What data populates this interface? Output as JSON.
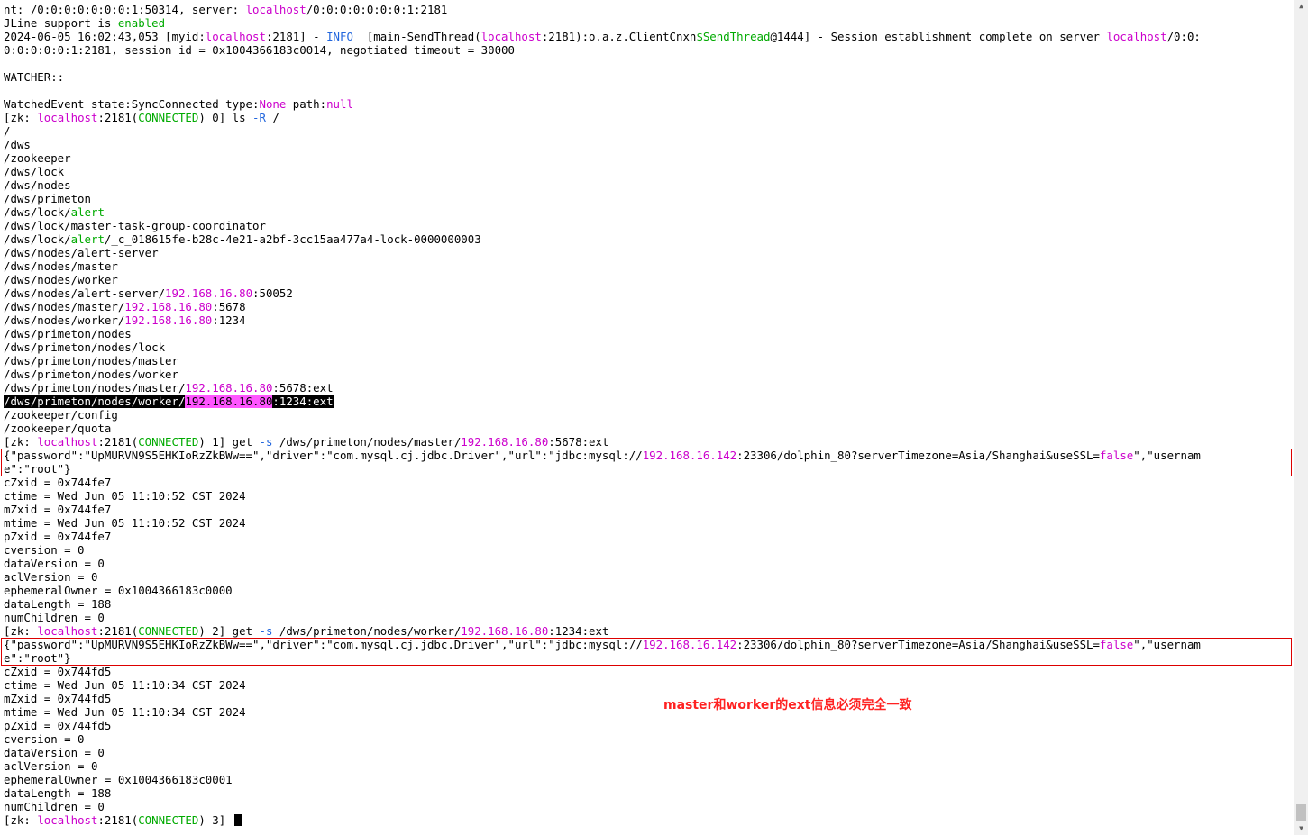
{
  "terminal": {
    "lines": [
      [
        [
          "nt: /0:0:0:0:0:0:0:1:50314, server: ",
          ""
        ],
        [
          "localhost",
          "mag"
        ],
        [
          "/0:0:0:0:0:0:0:1:2181",
          ""
        ]
      ],
      [
        [
          "JLine support is ",
          ""
        ],
        [
          "enabled",
          "grn"
        ]
      ],
      [
        [
          "2024-06-05 16:02:43,053 [myid:",
          ""
        ],
        [
          "localhost",
          "mag"
        ],
        [
          ":2181] - ",
          ""
        ],
        [
          "INFO",
          "blu"
        ],
        [
          "  [main-SendThread(",
          ""
        ],
        [
          "localhost",
          "mag"
        ],
        [
          ":2181):o.a.z.ClientCnxn",
          ""
        ],
        [
          "$SendThread",
          "grn"
        ],
        [
          "@1444] - Session establishment complete on server ",
          ""
        ],
        [
          "localhost",
          "mag"
        ],
        [
          "/0:0:",
          ""
        ]
      ],
      [
        [
          "0:0:0:0:0:1:2181, session id = 0x1004366183c0014, negotiated timeout = 30000",
          ""
        ]
      ],
      [
        [
          "",
          ""
        ]
      ],
      [
        [
          "WATCHER::",
          ""
        ]
      ],
      [
        [
          "",
          ""
        ]
      ],
      [
        [
          "WatchedEvent state:SyncConnected type:",
          ""
        ],
        [
          "None",
          "mag"
        ],
        [
          " path:",
          ""
        ],
        [
          "null",
          "mag"
        ]
      ],
      [
        [
          "[zk: ",
          ""
        ],
        [
          "localhost",
          "mag"
        ],
        [
          ":2181(",
          ""
        ],
        [
          "CONNECTED",
          "grn"
        ],
        [
          ") 0] ls ",
          ""
        ],
        [
          "-R",
          "blu"
        ],
        [
          " /",
          ""
        ]
      ],
      [
        [
          "/",
          ""
        ]
      ],
      [
        [
          "/dws",
          ""
        ]
      ],
      [
        [
          "/zookeeper",
          ""
        ]
      ],
      [
        [
          "/dws/lock",
          ""
        ]
      ],
      [
        [
          "/dws/nodes",
          ""
        ]
      ],
      [
        [
          "/dws/primeton",
          ""
        ]
      ],
      [
        [
          "/dws/lock/",
          ""
        ],
        [
          "alert",
          "grn"
        ]
      ],
      [
        [
          "/dws/lock/master-task-group-coordinator",
          ""
        ]
      ],
      [
        [
          "/dws/lock/",
          ""
        ],
        [
          "alert",
          "grn"
        ],
        [
          "/_c_018615fe-b28c-4e21-a2bf-3cc15aa477a4-lock-0000000003",
          ""
        ]
      ],
      [
        [
          "/dws/nodes/alert-server",
          ""
        ]
      ],
      [
        [
          "/dws/nodes/master",
          ""
        ]
      ],
      [
        [
          "/dws/nodes/worker",
          ""
        ]
      ],
      [
        [
          "/dws/nodes/alert-server/",
          ""
        ],
        [
          "192.168.16.80",
          "mag"
        ],
        [
          ":50052",
          ""
        ]
      ],
      [
        [
          "/dws/nodes/master/",
          ""
        ],
        [
          "192.168.16.80",
          "mag"
        ],
        [
          ":5678",
          ""
        ]
      ],
      [
        [
          "/dws/nodes/worker/",
          ""
        ],
        [
          "192.168.16.80",
          "mag"
        ],
        [
          ":1234",
          ""
        ]
      ],
      [
        [
          "/dws/primeton/nodes",
          ""
        ]
      ],
      [
        [
          "/dws/primeton/nodes/lock",
          ""
        ]
      ],
      [
        [
          "/dws/primeton/nodes/master",
          ""
        ]
      ],
      [
        [
          "/dws/primeton/nodes/worker",
          ""
        ]
      ],
      [
        [
          "/dws/primeton/nodes/master/",
          ""
        ],
        [
          "192.168.16.80",
          "mag"
        ],
        [
          ":5678:ext",
          ""
        ]
      ],
      [
        [
          "/dws/primeton/nodes/worker/",
          "sel"
        ],
        [
          "192.168.16.80",
          "selip"
        ],
        [
          ":1234:ext",
          "sel"
        ]
      ],
      [
        [
          "/zookeeper/config",
          ""
        ]
      ],
      [
        [
          "/zookeeper/quota",
          ""
        ]
      ],
      [
        [
          "[zk: ",
          ""
        ],
        [
          "localhost",
          "mag"
        ],
        [
          ":2181(",
          ""
        ],
        [
          "CONNECTED",
          "grn"
        ],
        [
          ") 1] get ",
          ""
        ],
        [
          "-s",
          "blu"
        ],
        [
          " /dws/primeton/nodes/master/",
          ""
        ],
        [
          "192.168.16.80",
          "mag"
        ],
        [
          ":5678:ext",
          ""
        ]
      ],
      [
        [
          "{\"password\":\"UpMURVN9S5EHKIoRzZkBWw==\",\"driver\":\"com.mysql.cj.jdbc.Driver\",\"url\":\"jdbc:mysql://",
          ""
        ],
        [
          "192.168.16.142",
          "mag"
        ],
        [
          ":23306/dolphin_80?serverTimezone=Asia/Shanghai&useSSL=",
          ""
        ],
        [
          "false",
          "mag"
        ],
        [
          "\",\"usernam",
          ""
        ]
      ],
      [
        [
          "e\":\"root\"}",
          ""
        ]
      ],
      [
        [
          "cZxid = 0x744fe7",
          ""
        ]
      ],
      [
        [
          "ctime = Wed Jun 05 11:10:52 CST 2024",
          ""
        ]
      ],
      [
        [
          "mZxid = 0x744fe7",
          ""
        ]
      ],
      [
        [
          "mtime = Wed Jun 05 11:10:52 CST 2024",
          ""
        ]
      ],
      [
        [
          "pZxid = 0x744fe7",
          ""
        ]
      ],
      [
        [
          "cversion = 0",
          ""
        ]
      ],
      [
        [
          "dataVersion = 0",
          ""
        ]
      ],
      [
        [
          "aclVersion = 0",
          ""
        ]
      ],
      [
        [
          "ephemeralOwner = 0x1004366183c0000",
          ""
        ]
      ],
      [
        [
          "dataLength = 188",
          ""
        ]
      ],
      [
        [
          "numChildren = 0",
          ""
        ]
      ],
      [
        [
          "[zk: ",
          ""
        ],
        [
          "localhost",
          "mag"
        ],
        [
          ":2181(",
          ""
        ],
        [
          "CONNECTED",
          "grn"
        ],
        [
          ") 2] get ",
          ""
        ],
        [
          "-s",
          "blu"
        ],
        [
          " /dws/primeton/nodes/worker/",
          ""
        ],
        [
          "192.168.16.80",
          "mag"
        ],
        [
          ":1234:ext",
          ""
        ]
      ],
      [
        [
          "{\"password\":\"UpMURVN9S5EHKIoRzZkBWw==\",\"driver\":\"com.mysql.cj.jdbc.Driver\",\"url\":\"jdbc:mysql://",
          ""
        ],
        [
          "192.168.16.142",
          "mag"
        ],
        [
          ":23306/dolphin_80?serverTimezone=Asia/Shanghai&useSSL=",
          ""
        ],
        [
          "false",
          "mag"
        ],
        [
          "\",\"usernam",
          ""
        ]
      ],
      [
        [
          "e\":\"root\"}",
          ""
        ]
      ],
      [
        [
          "cZxid = 0x744fd5",
          ""
        ]
      ],
      [
        [
          "ctime = Wed Jun 05 11:10:34 CST 2024",
          ""
        ]
      ],
      [
        [
          "mZxid = 0x744fd5",
          ""
        ]
      ],
      [
        [
          "mtime = Wed Jun 05 11:10:34 CST 2024",
          ""
        ]
      ],
      [
        [
          "pZxid = 0x744fd5",
          ""
        ]
      ],
      [
        [
          "cversion = 0",
          ""
        ]
      ],
      [
        [
          "dataVersion = 0",
          ""
        ]
      ],
      [
        [
          "aclVersion = 0",
          ""
        ]
      ],
      [
        [
          "ephemeralOwner = 0x1004366183c0001",
          ""
        ]
      ],
      [
        [
          "dataLength = 188",
          ""
        ]
      ],
      [
        [
          "numChildren = 0",
          ""
        ]
      ],
      [
        [
          "[zk: ",
          ""
        ],
        [
          "localhost",
          "mag"
        ],
        [
          ":2181(",
          ""
        ],
        [
          "CONNECTED",
          "grn"
        ],
        [
          ") 3] ",
          ""
        ]
      ]
    ]
  },
  "annotation": {
    "note": "master和worker的ext信息必须完全一致",
    "box_color": "#dd0000",
    "note_color": "#ff2222"
  },
  "colors": {
    "magenta": "#cc00cc",
    "green": "#00aa00",
    "blue": "#2266dd",
    "selection_bg": "#000000",
    "selection_ip_bg": "#ff55ff"
  },
  "icons": {
    "scroll_up": "▲",
    "scroll_down": "▼"
  }
}
